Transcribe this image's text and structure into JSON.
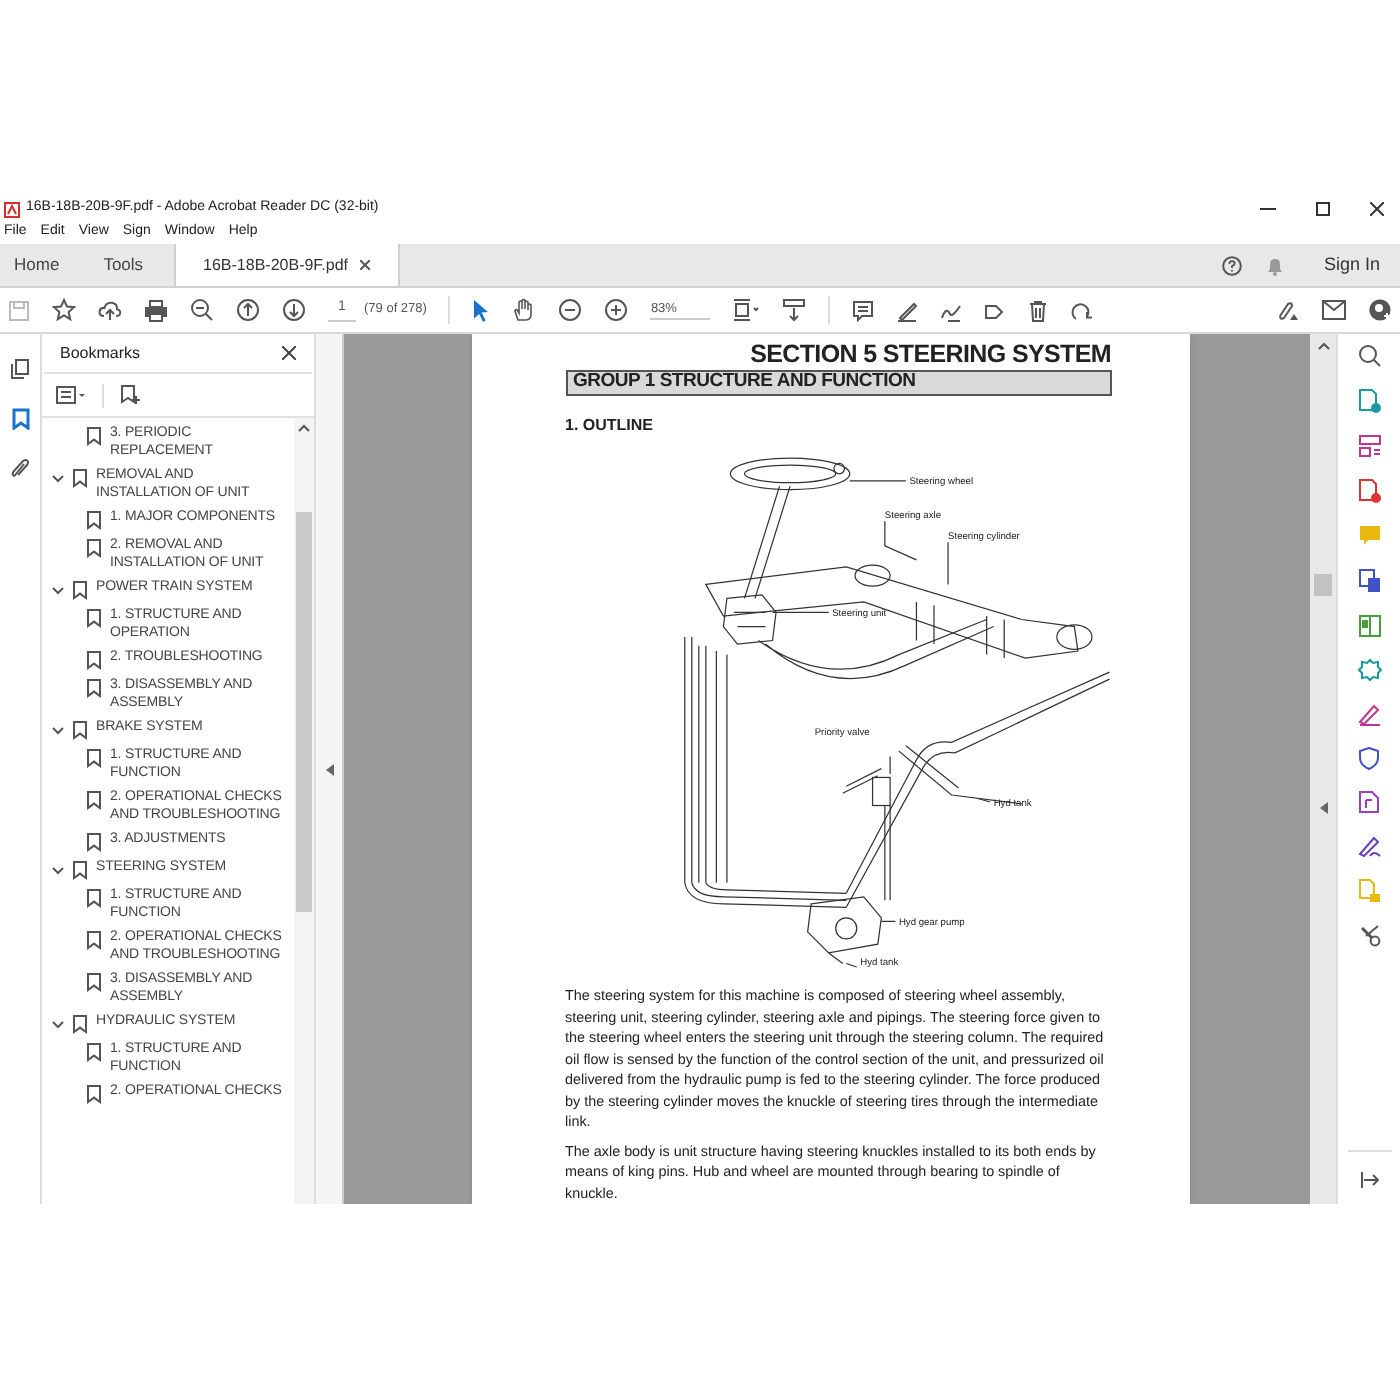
{
  "window": {
    "title": "16B-18B-20B-9F.pdf - Adobe Acrobat Reader DC (32-bit)"
  },
  "menu": [
    "File",
    "Edit",
    "View",
    "Sign",
    "Window",
    "Help"
  ],
  "tabs": [
    {
      "label": "Home",
      "selected": false,
      "closable": false
    },
    {
      "label": "Tools",
      "selected": false,
      "closable": false
    },
    {
      "label": "16B-18B-20B-9F.pdf",
      "selected": true,
      "closable": true
    }
  ],
  "sign_in": "Sign In",
  "toolbar": {
    "page_number": "1",
    "page_count": "(79 of 278)",
    "zoom": "83%"
  },
  "bookmarks_panel": {
    "title": "Bookmarks",
    "items": [
      {
        "label": "3. PERIODIC REPLACEMENT"
      },
      {
        "label": "REMOVAL AND INSTALLATION OF UNIT",
        "expanded": true,
        "children": [
          {
            "label": "1. MAJOR COMPONENTS"
          },
          {
            "label": "2. REMOVAL AND INSTALLATION OF UNIT"
          }
        ]
      },
      {
        "label": "POWER TRAIN SYSTEM",
        "expanded": true,
        "children": [
          {
            "label": "1. STRUCTURE AND OPERATION"
          },
          {
            "label": "2. TROUBLESHOOTING"
          },
          {
            "label": "3. DISASSEMBLY AND ASSEMBLY"
          }
        ]
      },
      {
        "label": "BRAKE SYSTEM",
        "expanded": true,
        "children": [
          {
            "label": "1. STRUCTURE AND FUNCTION"
          },
          {
            "label": "2. OPERATIONAL CHECKS AND TROUBLESHOOTING"
          },
          {
            "label": "3. ADJUSTMENTS"
          }
        ]
      },
      {
        "label": "STEERING SYSTEM",
        "expanded": true,
        "children": [
          {
            "label": "1. STRUCTURE AND FUNCTION"
          },
          {
            "label": "2. OPERATIONAL CHECKS AND TROUBLESHOOTING"
          },
          {
            "label": "3. DISASSEMBLY AND ASSEMBLY"
          }
        ]
      },
      {
        "label": "HYDRAULIC SYSTEM",
        "expanded": true,
        "children": [
          {
            "label": "1. STRUCTURE AND FUNCTION"
          },
          {
            "label": "2. OPERATIONAL CHECKS"
          }
        ]
      }
    ]
  },
  "page": {
    "section_title": "SECTION 5  STEERING SYSTEM",
    "group_title": "GROUP 1  STRUCTURE AND FUNCTION",
    "heading": "1. OUTLINE",
    "figure_labels": [
      "Steering wheel",
      "Steering axle",
      "Steering cylinder",
      "Steering unit",
      "Priority valve",
      "Hyd tank",
      "Hyd gear pump",
      "Hyd tank"
    ],
    "paragraphs": [
      "The steering system for this machine is composed of steering wheel assembly, steering unit, steering cylinder, steering axle and pipings.  The steering force given to the steering wheel enters the steering unit through the steering column.  The required oil flow is sensed by the function of the control section of the unit, and pressurized oil delivered from the hydraulic pump is fed to the steering cylinder.  The force produced by the steering cylinder moves the knuckle of steering tires through the intermediate link.",
      "The axle body is unit structure having steering knuckles installed to its both ends by means of king pins. Hub and wheel are mounted through bearing to spindle of knuckle."
    ]
  }
}
